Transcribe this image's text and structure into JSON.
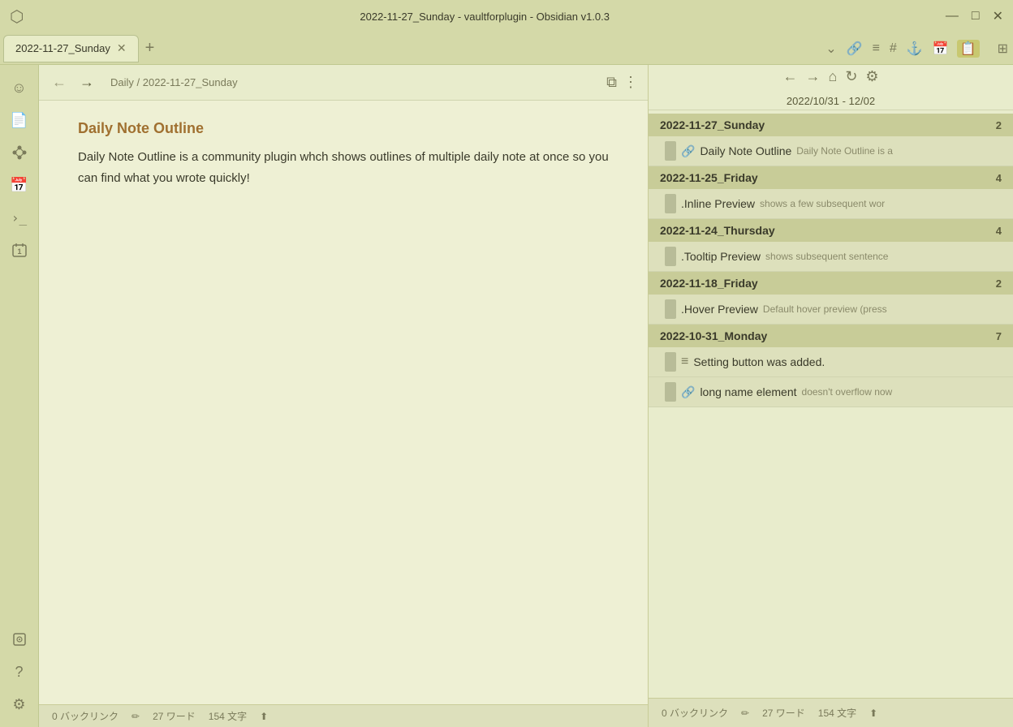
{
  "window": {
    "title": "2022-11-27_Sunday - vaultforplugin - Obsidian v1.0.3",
    "minimize": "—",
    "maximize": "□",
    "close": "✕"
  },
  "tabs": [
    {
      "label": "2022-11-27_Sunday",
      "active": true
    }
  ],
  "tab_new": "+",
  "tab_bar_right": "⌄",
  "toolbar_icons": [
    "🔗",
    "≡",
    "#",
    "🔗",
    "📅",
    "📋",
    "⊞"
  ],
  "editor": {
    "back": "←",
    "forward": "→",
    "breadcrumb": "Daily / 2022-11-27_Sunday",
    "reading_view_icon": "⧉",
    "more_icon": "⋮",
    "heading": "Daily Note Outline",
    "body": "Daily Note Outline is a community plugin whch shows outlines of multiple daily note at once so you can find what you wrote quickly!"
  },
  "right_panel": {
    "back": "←",
    "forward": "→",
    "home": "⌂",
    "refresh": "↻",
    "settings": "⚙",
    "date_range": "2022/10/31 - 12/02",
    "dates": [
      {
        "label": "2022-11-27_Sunday",
        "count": 2,
        "items": [
          {
            "icon": "🔗",
            "title": "Daily Note Outline",
            "preview": "Daily Note Outline is a"
          }
        ]
      },
      {
        "label": "2022-11-25_Friday",
        "count": 4,
        "items": [
          {
            "icon": ".",
            "title": ".Inline Preview",
            "preview": "shows a few subsequent wor"
          }
        ]
      },
      {
        "label": "2022-11-24_Thursday",
        "count": 4,
        "items": [
          {
            "icon": ".",
            "title": ".Tooltip Preview",
            "preview": "shows subsequent sentence"
          }
        ]
      },
      {
        "label": "2022-11-18_Friday",
        "count": 2,
        "items": [
          {
            "icon": ".",
            "title": ".Hover Preview",
            "preview": "Default hover preview (press"
          }
        ]
      },
      {
        "label": "2022-10-31_Monday",
        "count": 7,
        "items": [
          {
            "icon": "≡",
            "title": "Setting button was added.",
            "preview": ""
          },
          {
            "icon": "🔗",
            "title": "long name element",
            "preview": "doesn't overflow now"
          }
        ]
      }
    ]
  },
  "statusbar": {
    "backlinks": "0 バックリンク",
    "words": "27 ワード",
    "chars": "154 文字"
  },
  "sidebar_icons": {
    "top": [
      "☺",
      "📄",
      "⚙",
      "📅",
      ">_",
      "📋"
    ],
    "bottom": [
      "📍",
      "?",
      "⚙"
    ]
  }
}
